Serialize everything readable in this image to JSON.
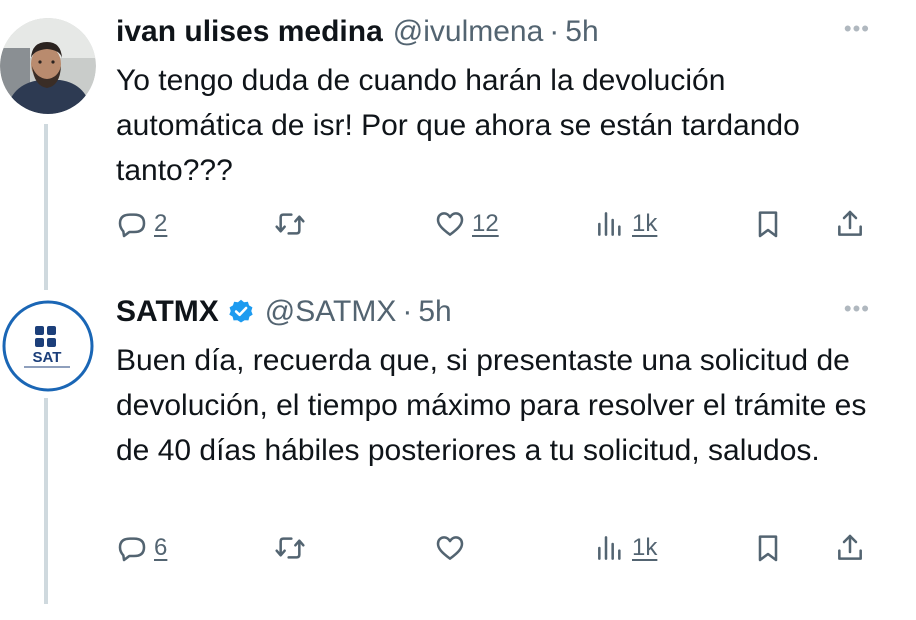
{
  "tweets": [
    {
      "name": "ivan ulises medina",
      "handle": "@ivulmena",
      "time": "5h",
      "text": "Yo tengo duda de cuando harán la devolución automática de isr! Por que ahora se están tardando tanto???",
      "verified": false,
      "avatar_icon": "user-photo-avatar",
      "more_label": "•••",
      "counts": {
        "replies": "2",
        "retweets": "",
        "likes": "12",
        "views": "1k"
      }
    },
    {
      "name": "SATMX",
      "handle": "@SATMX",
      "time": "5h",
      "text": "Buen día, recuerda que, si presentaste una solicitud de devolución, el tiempo máximo para resolver el trámite es de 40 días hábiles posteriores a tu solicitud, saludos.",
      "verified": true,
      "avatar_icon": "sat-logo-avatar",
      "avatar_text": "SAT",
      "more_label": "•••",
      "counts": {
        "replies": "6",
        "retweets": "",
        "likes": "",
        "views": "1k"
      }
    }
  ],
  "separator": "·",
  "colors": {
    "text": "#0f1419",
    "muted": "#536471",
    "thread_line": "#cfd9de",
    "verified": "#1d9bf0",
    "sat_ring": "#1a66b5",
    "sat_text": "#1c3f7a"
  }
}
